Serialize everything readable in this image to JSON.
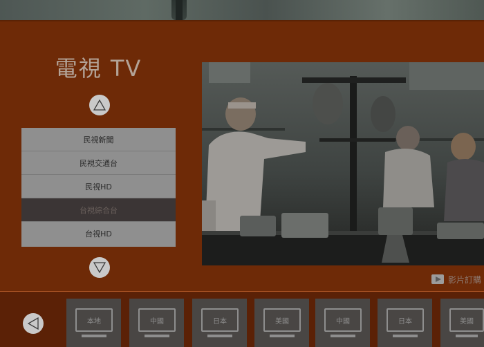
{
  "app": {
    "title": "電視 TV"
  },
  "channels": {
    "items": [
      {
        "label": "民視新聞",
        "selected": false
      },
      {
        "label": "民視交通台",
        "selected": false
      },
      {
        "label": "民視HD",
        "selected": false
      },
      {
        "label": "台視綜合台",
        "selected": true
      },
      {
        "label": "台視HD",
        "selected": false
      }
    ]
  },
  "controls": {
    "up_icon": "triangle-up-icon",
    "down_icon": "triangle-down-icon",
    "left_icon": "triangle-left-icon"
  },
  "subscribe": {
    "label": "影片訂購",
    "icon": "subscribe-icon"
  },
  "regions": [
    {
      "label": "本地"
    },
    {
      "label": "中國"
    },
    {
      "label": "日本"
    },
    {
      "label": "美國"
    },
    {
      "label": "中國"
    },
    {
      "label": "日本"
    },
    {
      "label": "美國"
    }
  ],
  "colors": {
    "background": "#6e2a07",
    "bottom_bar": "#5b2106",
    "selected_item": "#3b3535"
  }
}
